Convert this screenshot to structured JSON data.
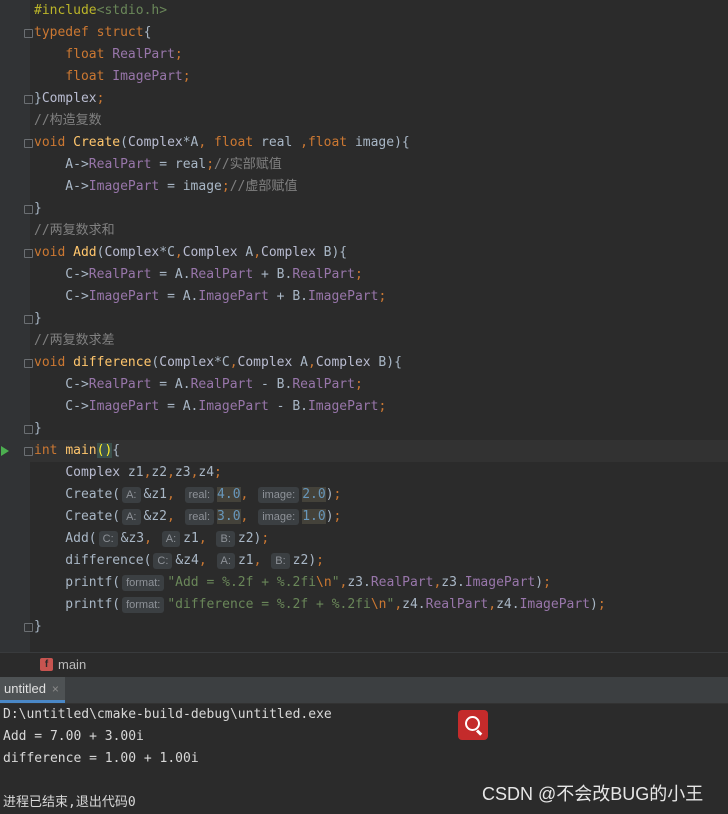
{
  "editor": {
    "lines": [
      [
        [
          "pp",
          "#include"
        ],
        [
          "hdr",
          "<stdio.h>"
        ]
      ],
      [
        [
          "kw",
          "typedef "
        ],
        [
          "kw",
          "struct"
        ],
        [
          "txt",
          "{"
        ]
      ],
      [
        [
          "txt",
          "    "
        ],
        [
          "kw",
          "float "
        ],
        [
          "fld",
          "RealPart"
        ],
        [
          "punc",
          ";"
        ]
      ],
      [
        [
          "txt",
          "    "
        ],
        [
          "kw",
          "float "
        ],
        [
          "fld",
          "ImagePart"
        ],
        [
          "punc",
          ";"
        ]
      ],
      [
        [
          "txt",
          "}"
        ],
        [
          "type",
          "Complex"
        ],
        [
          "punc",
          ";"
        ]
      ],
      [
        [
          "cmt",
          "//构造复数"
        ]
      ],
      [
        [
          "kw",
          "void "
        ],
        [
          "fn",
          "Create"
        ],
        [
          "txt",
          "("
        ],
        [
          "type",
          "Complex"
        ],
        [
          "txt",
          "*A"
        ],
        [
          "punc",
          ", "
        ],
        [
          "kw",
          "float "
        ],
        [
          "txt",
          "real "
        ],
        [
          "punc",
          ","
        ],
        [
          "kw",
          "float "
        ],
        [
          "txt",
          "image){"
        ]
      ],
      [
        [
          "txt",
          "    A->"
        ],
        [
          "fld",
          "RealPart"
        ],
        [
          "txt",
          " = real"
        ],
        [
          "punc",
          ";"
        ],
        [
          "cmt",
          "//实部赋值"
        ]
      ],
      [
        [
          "txt",
          "    A->"
        ],
        [
          "fld",
          "ImagePart"
        ],
        [
          "txt",
          " = image"
        ],
        [
          "punc",
          ";"
        ],
        [
          "cmt",
          "//虚部赋值"
        ]
      ],
      [
        [
          "txt",
          "}"
        ]
      ],
      [
        [
          "cmt",
          "//两复数求和"
        ]
      ],
      [
        [
          "kw",
          "void "
        ],
        [
          "fn",
          "Add"
        ],
        [
          "txt",
          "("
        ],
        [
          "type",
          "Complex"
        ],
        [
          "txt",
          "*C"
        ],
        [
          "punc",
          ","
        ],
        [
          "type",
          "Complex"
        ],
        [
          "txt",
          " A"
        ],
        [
          "punc",
          ","
        ],
        [
          "type",
          "Complex"
        ],
        [
          "txt",
          " B){"
        ]
      ],
      [
        [
          "txt",
          "    C->"
        ],
        [
          "fld",
          "RealPart"
        ],
        [
          "txt",
          " = A."
        ],
        [
          "fld",
          "RealPart"
        ],
        [
          "txt",
          " + B."
        ],
        [
          "fld",
          "RealPart"
        ],
        [
          "punc",
          ";"
        ]
      ],
      [
        [
          "txt",
          "    C->"
        ],
        [
          "fld",
          "ImagePart"
        ],
        [
          "txt",
          " = A."
        ],
        [
          "fld",
          "ImagePart"
        ],
        [
          "txt",
          " + B."
        ],
        [
          "fld",
          "ImagePart"
        ],
        [
          "punc",
          ";"
        ]
      ],
      [
        [
          "txt",
          "}"
        ]
      ],
      [
        [
          "cmt",
          "//两复数求差"
        ]
      ],
      [
        [
          "kw",
          "void "
        ],
        [
          "fn",
          "difference"
        ],
        [
          "txt",
          "("
        ],
        [
          "type",
          "Complex"
        ],
        [
          "txt",
          "*C"
        ],
        [
          "punc",
          ","
        ],
        [
          "type",
          "Complex"
        ],
        [
          "txt",
          " A"
        ],
        [
          "punc",
          ","
        ],
        [
          "type",
          "Complex"
        ],
        [
          "txt",
          " B){"
        ]
      ],
      [
        [
          "txt",
          "    C->"
        ],
        [
          "fld",
          "RealPart"
        ],
        [
          "txt",
          " = A."
        ],
        [
          "fld",
          "RealPart"
        ],
        [
          "txt",
          " - B."
        ],
        [
          "fld",
          "RealPart"
        ],
        [
          "punc",
          ";"
        ]
      ],
      [
        [
          "txt",
          "    C->"
        ],
        [
          "fld",
          "ImagePart"
        ],
        [
          "txt",
          " = A."
        ],
        [
          "fld",
          "ImagePart"
        ],
        [
          "txt",
          " - B."
        ],
        [
          "fld",
          "ImagePart"
        ],
        [
          "punc",
          ";"
        ]
      ],
      [
        [
          "txt",
          "}"
        ]
      ],
      [
        [
          "kw",
          "int "
        ],
        [
          "fn",
          "main"
        ],
        [
          "brk",
          "()"
        ],
        [
          "txt",
          "{"
        ]
      ],
      [
        [
          "txt",
          "    "
        ],
        [
          "type",
          "Complex"
        ],
        [
          "txt",
          " z1"
        ],
        [
          "punc",
          ","
        ],
        [
          "txt",
          "z2"
        ],
        [
          "punc",
          ","
        ],
        [
          "txt",
          "z3"
        ],
        [
          "punc",
          ","
        ],
        [
          "txt",
          "z4"
        ],
        [
          "punc",
          ";"
        ]
      ],
      [
        [
          "txt",
          "    Create("
        ],
        [
          "hint",
          "A:"
        ],
        [
          "txt",
          "&z1"
        ],
        [
          "punc",
          ", "
        ],
        [
          "hint",
          "real:"
        ],
        [
          "numhl",
          "4.0"
        ],
        [
          "punc",
          ", "
        ],
        [
          "hint",
          "image:"
        ],
        [
          "numhl",
          "2.0"
        ],
        [
          "txt",
          ")"
        ],
        [
          "punc",
          ";"
        ]
      ],
      [
        [
          "txt",
          "    Create("
        ],
        [
          "hint",
          "A:"
        ],
        [
          "txt",
          "&z2"
        ],
        [
          "punc",
          ", "
        ],
        [
          "hint",
          "real:"
        ],
        [
          "numhl",
          "3.0"
        ],
        [
          "punc",
          ", "
        ],
        [
          "hint",
          "image:"
        ],
        [
          "numhl",
          "1.0"
        ],
        [
          "txt",
          ")"
        ],
        [
          "punc",
          ";"
        ]
      ],
      [
        [
          "txt",
          "    Add("
        ],
        [
          "hint",
          "C:"
        ],
        [
          "txt",
          "&z3"
        ],
        [
          "punc",
          ", "
        ],
        [
          "hint",
          "A:"
        ],
        [
          "txt",
          "z1"
        ],
        [
          "punc",
          ", "
        ],
        [
          "hint",
          "B:"
        ],
        [
          "txt",
          "z2)"
        ],
        [
          "punc",
          ";"
        ]
      ],
      [
        [
          "txt",
          "    difference("
        ],
        [
          "hint",
          "C:"
        ],
        [
          "txt",
          "&z4"
        ],
        [
          "punc",
          ", "
        ],
        [
          "hint",
          "A:"
        ],
        [
          "txt",
          "z1"
        ],
        [
          "punc",
          ", "
        ],
        [
          "hint",
          "B:"
        ],
        [
          "txt",
          "z2)"
        ],
        [
          "punc",
          ";"
        ]
      ],
      [
        [
          "txt",
          "    printf("
        ],
        [
          "hint",
          "format:"
        ],
        [
          "str",
          "\"Add = %.2f + %.2fi"
        ],
        [
          "esc",
          "\\n"
        ],
        [
          "str",
          "\""
        ],
        [
          "punc",
          ","
        ],
        [
          "txt",
          "z3."
        ],
        [
          "fld",
          "RealPart"
        ],
        [
          "punc",
          ","
        ],
        [
          "txt",
          "z3."
        ],
        [
          "fld",
          "ImagePart"
        ],
        [
          "txt",
          ")"
        ],
        [
          "punc",
          ";"
        ]
      ],
      [
        [
          "txt",
          "    printf("
        ],
        [
          "hint",
          "format:"
        ],
        [
          "str",
          "\"difference = %.2f + %.2fi"
        ],
        [
          "esc",
          "\\n"
        ],
        [
          "str",
          "\""
        ],
        [
          "punc",
          ","
        ],
        [
          "txt",
          "z4."
        ],
        [
          "fld",
          "RealPart"
        ],
        [
          "punc",
          ","
        ],
        [
          "txt",
          "z4."
        ],
        [
          "fld",
          "ImagePart"
        ],
        [
          "txt",
          ")"
        ],
        [
          "punc",
          ";"
        ]
      ],
      [
        [
          "txt",
          "}"
        ]
      ]
    ]
  },
  "breadcrumb": {
    "badge": "f",
    "label": "main"
  },
  "run_tab": {
    "label": "untitled",
    "close": "×"
  },
  "console": {
    "lines": [
      "D:\\untitled\\cmake-build-debug\\untitled.exe",
      "Add = 7.00 + 3.00i",
      "difference = 1.00 + 1.00i",
      "",
      "进程已结束,退出代码0"
    ]
  },
  "watermark": "CSDN @不会改BUG的小王",
  "icons": {
    "run": "run-gutter-icon",
    "search": "search-icon"
  }
}
